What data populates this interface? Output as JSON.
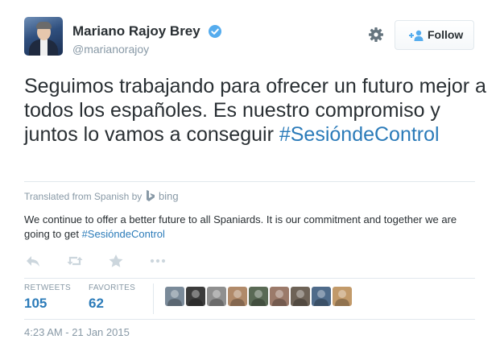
{
  "author": {
    "name": "Mariano Rajoy Brey",
    "handle": "@marianorajoy",
    "verified": true
  },
  "follow_button": {
    "label": "Follow"
  },
  "tweet": {
    "text": "Seguimos trabajando para ofrecer un futuro mejor a todos los españoles. Es nuestro compromiso y juntos lo vamos a conseguir",
    "hashtag": "#SesióndeControl"
  },
  "translation": {
    "label": "Translated from Spanish by",
    "provider": "bing",
    "text": "We continue to offer a better future to all Spaniards. It is our commitment and together we are going to get",
    "hashtag": "#SesióndeControl"
  },
  "actions": [
    "reply-icon",
    "retweet-icon",
    "favorite-icon",
    "more-icon"
  ],
  "stats": {
    "retweets_label": "RETWEETS",
    "retweets_count": "105",
    "favorites_label": "FAVORITES",
    "favorites_count": "62"
  },
  "favoriters": [
    {
      "color": "#7a8a99"
    },
    {
      "color": "#3b3b3b"
    },
    {
      "color": "#8f8f8f"
    },
    {
      "color": "#b08a6a"
    },
    {
      "color": "#5a6a55"
    },
    {
      "color": "#9b7a6a"
    },
    {
      "color": "#6e6357"
    },
    {
      "color": "#4f6b8a"
    },
    {
      "color": "#c29a6a"
    }
  ],
  "timestamp": "4:23 AM - 21 Jan 2015",
  "colors": {
    "link": "#2b7bb9",
    "muted": "#8899a6",
    "verified": "#55acee",
    "text": "#292f33"
  }
}
